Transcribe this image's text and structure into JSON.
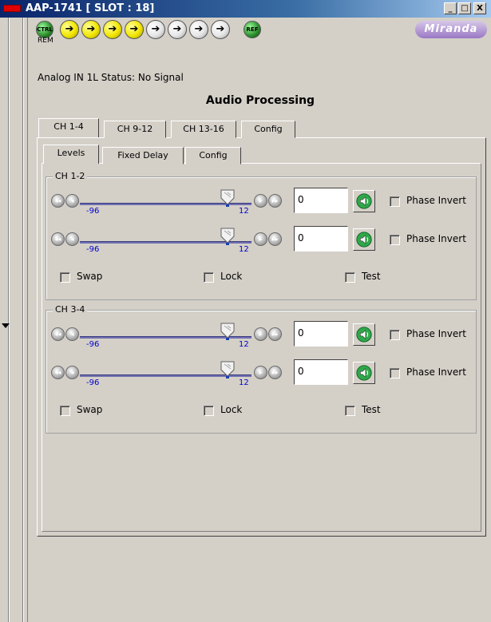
{
  "window": {
    "title": "AAP-1741 [ SLOT : 18]",
    "minimize_label": "_",
    "maximize_label": "□",
    "close_label": "X"
  },
  "header": {
    "leds": [
      {
        "name": "ctrl-led",
        "label": "CTRL",
        "color": "green"
      },
      {
        "name": "arrow-led-1",
        "label": "➔",
        "color": "yellow"
      },
      {
        "name": "arrow-led-2",
        "label": "➔",
        "color": "yellow"
      },
      {
        "name": "arrow-led-3",
        "label": "➔",
        "color": "yellow"
      },
      {
        "name": "arrow-led-4",
        "label": "➔",
        "color": "yellow"
      },
      {
        "name": "arrow-led-5",
        "label": "➔",
        "color": "white"
      },
      {
        "name": "arrow-led-6",
        "label": "➔",
        "color": "white"
      },
      {
        "name": "arrow-led-7",
        "label": "➔",
        "color": "white"
      },
      {
        "name": "arrow-led-8",
        "label": "➔",
        "color": "white"
      },
      {
        "name": "ref-led",
        "label": "REF",
        "color": "green"
      }
    ],
    "rem_label": "REM",
    "brand": "Miranda",
    "status_text": "Analog IN 1L Status: No Signal",
    "app_title": "Audio Processing"
  },
  "tabs": {
    "main": [
      {
        "label": "CH 1-4",
        "active": true
      },
      {
        "label": "CH 9-12",
        "active": false
      },
      {
        "label": "CH 13-16",
        "active": false
      },
      {
        "label": "Config",
        "active": false
      }
    ],
    "sub": [
      {
        "label": "Levels",
        "active": true
      },
      {
        "label": "Fixed Delay",
        "active": false
      },
      {
        "label": "Config",
        "active": false
      }
    ]
  },
  "groups": [
    {
      "title": "CH 1-2",
      "rows": [
        {
          "min_label": "-96",
          "max_label": "12",
          "level": 1.0,
          "value": "0",
          "phase_label": "Phase Invert",
          "phase_checked": false
        },
        {
          "min_label": "-96",
          "max_label": "12",
          "level": 1.0,
          "value": "0",
          "phase_label": "Phase Invert",
          "phase_checked": false
        }
      ],
      "options": [
        {
          "label": "Swap",
          "checked": false
        },
        {
          "label": "Lock",
          "checked": false
        },
        {
          "label": "Test",
          "checked": false
        }
      ]
    },
    {
      "title": "CH 3-4",
      "rows": [
        {
          "min_label": "-96",
          "max_label": "12",
          "level": 1.0,
          "value": "0",
          "phase_label": "Phase Invert",
          "phase_checked": false
        },
        {
          "min_label": "-96",
          "max_label": "12",
          "level": 1.0,
          "value": "0",
          "phase_label": "Phase Invert",
          "phase_checked": false
        }
      ],
      "options": [
        {
          "label": "Swap",
          "checked": false
        },
        {
          "label": "Lock",
          "checked": false
        },
        {
          "label": "Test",
          "checked": false
        }
      ]
    }
  ],
  "colors": {
    "label_blue": "#0000d0",
    "track": "#6f6fb0"
  }
}
